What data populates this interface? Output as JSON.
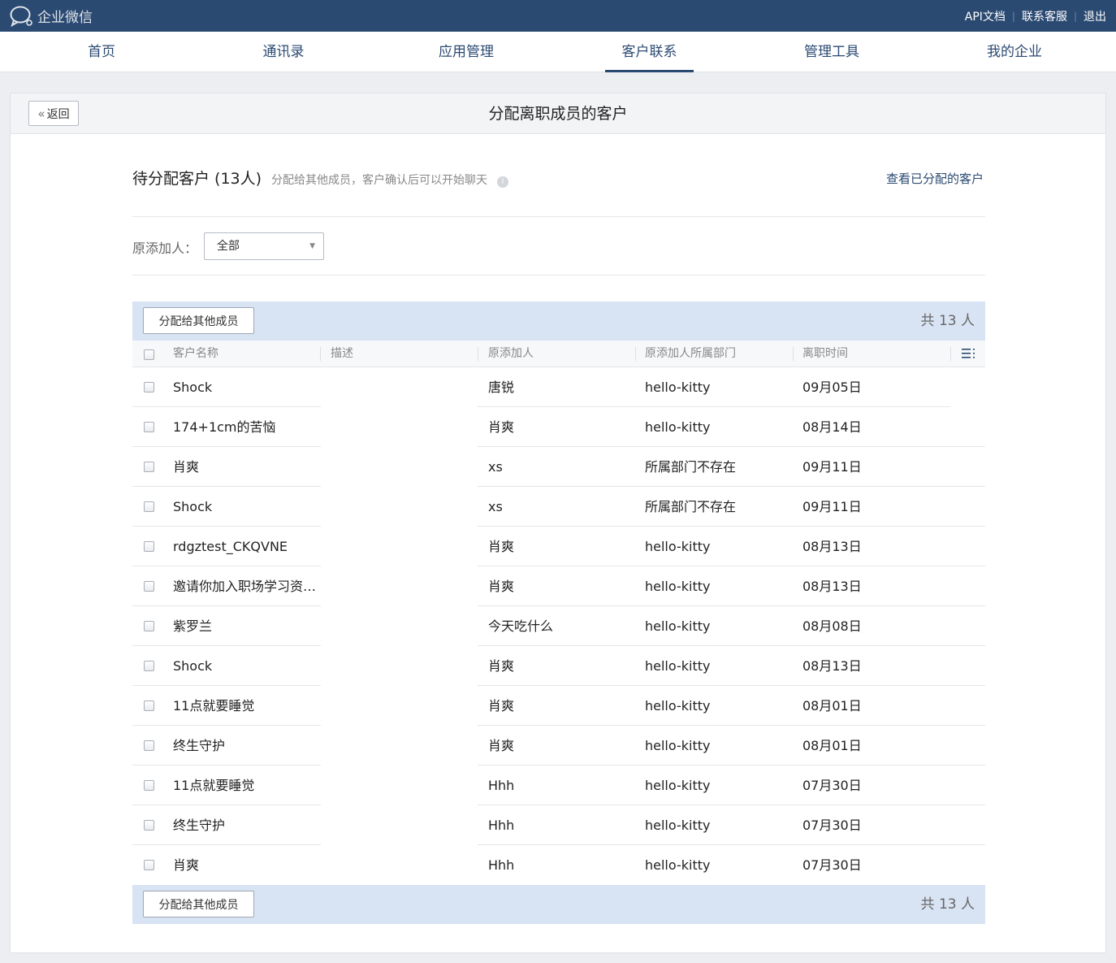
{
  "topbar": {
    "logo_text": "企业微信",
    "links": [
      "API文档",
      "联系客服",
      "退出"
    ]
  },
  "nav": {
    "items": [
      "首页",
      "通讯录",
      "应用管理",
      "客户联系",
      "管理工具",
      "我的企业"
    ],
    "active": "客户联系"
  },
  "panel": {
    "back_label": "返回",
    "title": "分配离职成员的客户"
  },
  "section": {
    "title": "待分配客户 (13人)",
    "subtitle": "分配给其他成员，客户确认后可以开始聊天",
    "view_assigned": "查看已分配的客户"
  },
  "filter": {
    "label": "原添加人：",
    "selected": "全部"
  },
  "toolbar": {
    "assign_label": "分配给其他成员",
    "count_label": "共 13 人"
  },
  "table": {
    "columns": [
      "客户名称",
      "描述",
      "原添加人",
      "原添加人所属部门",
      "离职时间"
    ],
    "rows": [
      {
        "name": "Shock",
        "desc": "",
        "adder": "唐锐",
        "dept": "hello-kitty",
        "time": "09月05日"
      },
      {
        "name": "174+1cm的苦恼",
        "desc": "",
        "adder": "肖爽",
        "dept": "hello-kitty",
        "time": "08月14日"
      },
      {
        "name": "肖爽",
        "desc": "",
        "adder": "xs",
        "dept": "所属部门不存在",
        "time": "09月11日"
      },
      {
        "name": "Shock",
        "desc": "",
        "adder": "xs",
        "dept": "所属部门不存在",
        "time": "09月11日"
      },
      {
        "name": "rdgztest_CKQVNE",
        "desc": "",
        "adder": "肖爽",
        "dept": "hello-kitty",
        "time": "08月13日"
      },
      {
        "name": "邀请你加入职场学习资…",
        "desc": "",
        "adder": "肖爽",
        "dept": "hello-kitty",
        "time": "08月13日"
      },
      {
        "name": "紫罗兰",
        "desc": "",
        "adder": "今天吃什么",
        "dept": "hello-kitty",
        "time": "08月08日"
      },
      {
        "name": "Shock",
        "desc": "",
        "adder": "肖爽",
        "dept": "hello-kitty",
        "time": "08月13日"
      },
      {
        "name": "11点就要睡觉",
        "desc": "",
        "adder": "肖爽",
        "dept": "hello-kitty",
        "time": "08月01日"
      },
      {
        "name": "终生守护",
        "desc": "",
        "adder": "肖爽",
        "dept": "hello-kitty",
        "time": "08月01日"
      },
      {
        "name": "11点就要睡觉",
        "desc": "",
        "adder": "Hhh",
        "dept": "hello-kitty",
        "time": "07月30日"
      },
      {
        "name": "终生守护",
        "desc": "",
        "adder": "Hhh",
        "dept": "hello-kitty",
        "time": "07月30日"
      },
      {
        "name": "肖爽",
        "desc": "",
        "adder": "Hhh",
        "dept": "hello-kitty",
        "time": "07月30日"
      }
    ]
  },
  "colors": {
    "topbar": "#2b4a72",
    "accent": "#2b4a72",
    "toolbar_bg": "#d8e3f3"
  }
}
